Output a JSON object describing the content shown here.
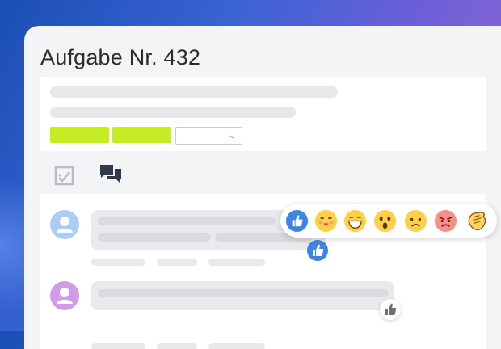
{
  "task": {
    "title": "Aufgabe Nr. 432"
  },
  "tabs": [
    {
      "icon": "checklist-icon",
      "active": false
    },
    {
      "icon": "chat-bubbles-icon",
      "active": true
    }
  ],
  "colors": {
    "accent": "#1d5fa8",
    "tag": "#c6ec26",
    "like_blue": "#3b86e0",
    "avatar_blue": "#a9cdf3",
    "avatar_purple": "#d29be8"
  },
  "reactions": [
    "like",
    "heart-kiss",
    "grin",
    "surprised",
    "sad",
    "angry",
    "clap"
  ],
  "comments": [
    {
      "avatar_color": "avatar_blue",
      "reaction": "like"
    },
    {
      "avatar_color": "avatar_purple",
      "reaction": "none"
    }
  ]
}
